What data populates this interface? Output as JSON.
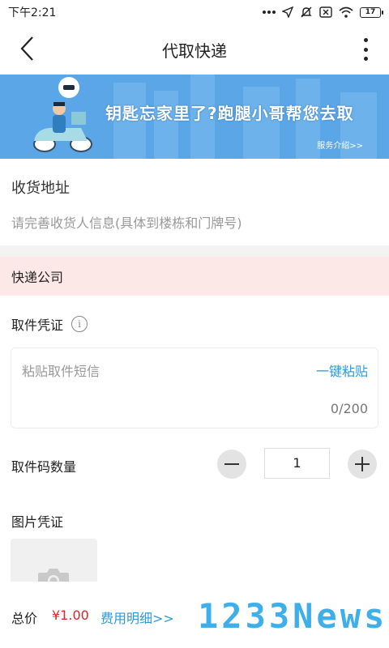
{
  "status_bar": {
    "time": "下午2:21",
    "battery": "17",
    "icons": [
      "dots-icon",
      "location-icon",
      "mute-icon",
      "close-box-icon",
      "wifi-icon",
      "battery-icon"
    ]
  },
  "navbar": {
    "title": "代取快递",
    "back_icon": "chevron-left-icon",
    "more_icon": "more-vertical-icon"
  },
  "banner": {
    "headline": "钥匙忘家里了?跑腿小哥帮您去取",
    "link": "服务介绍>>",
    "bg_color": "#5aa6e6"
  },
  "address": {
    "label": "收货地址",
    "placeholder": "请完善收货人信息(具体到楼栋和门牌号)"
  },
  "courier": {
    "label": "快递公司",
    "bg_color": "#fde8e8"
  },
  "pickup_cert": {
    "label": "取件凭证",
    "sms_placeholder": "粘贴取件短信",
    "paste_label": "一键粘贴",
    "char_count": "0/200"
  },
  "quantity": {
    "label": "取件码数量",
    "value": "1"
  },
  "photo": {
    "label": "图片凭证"
  },
  "footer": {
    "total_label": "总价",
    "total_price": "¥1.00",
    "fee_detail": "费用明细>>",
    "watermark": "1233News",
    "accent_color": "#2d9ad8",
    "price_color": "#d62828"
  }
}
